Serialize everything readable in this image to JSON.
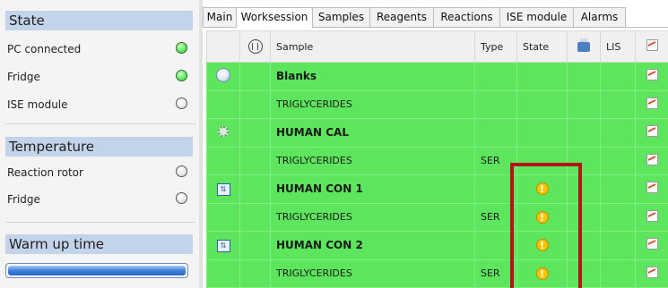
{
  "state": {
    "title": "State",
    "items": [
      {
        "label": "PC connected",
        "status": "on"
      },
      {
        "label": "Fridge",
        "status": "on"
      },
      {
        "label": "ISE module",
        "status": "off"
      }
    ]
  },
  "temperature": {
    "title": "Temperature",
    "items": [
      {
        "label": "Reaction rotor",
        "status": "off"
      },
      {
        "label": "Fridge",
        "status": "off"
      }
    ]
  },
  "warmup": {
    "title": "Warm up time",
    "progress": 1.0
  },
  "tabs": [
    {
      "label": "Main"
    },
    {
      "label": "Worksession",
      "active": true
    },
    {
      "label": "Samples"
    },
    {
      "label": "Reagents"
    },
    {
      "label": "Reactions"
    },
    {
      "label": "ISE module"
    },
    {
      "label": "Alarms"
    }
  ],
  "grid": {
    "headers": {
      "sample": "Sample",
      "type": "Type",
      "state": "State",
      "lis": "LIS"
    },
    "rows": [
      {
        "icon": "blank-icon",
        "sample": "Blanks",
        "bold": true,
        "type": "",
        "warning": false
      },
      {
        "icon": "",
        "sample": "TRIGLYCERIDES",
        "bold": false,
        "type": "",
        "warning": false
      },
      {
        "icon": "calibrator-icon",
        "sample": "HUMAN CAL",
        "bold": true,
        "type": "",
        "warning": false
      },
      {
        "icon": "",
        "sample": "TRIGLYCERIDES",
        "bold": false,
        "type": "SER",
        "warning": false
      },
      {
        "icon": "control-icon",
        "sample": "HUMAN CON 1",
        "bold": true,
        "type": "",
        "warning": true
      },
      {
        "icon": "",
        "sample": "TRIGLYCERIDES",
        "bold": false,
        "type": "SER",
        "warning": true
      },
      {
        "icon": "control-icon",
        "sample": "HUMAN CON 2",
        "bold": true,
        "type": "",
        "warning": true
      },
      {
        "icon": "",
        "sample": "TRIGLYCERIDES",
        "bold": false,
        "type": "SER",
        "warning": true
      }
    ]
  },
  "colors": {
    "row_bg": "#5ee55e",
    "highlight": "#b3151a",
    "section_head": "#c3d4ea"
  }
}
